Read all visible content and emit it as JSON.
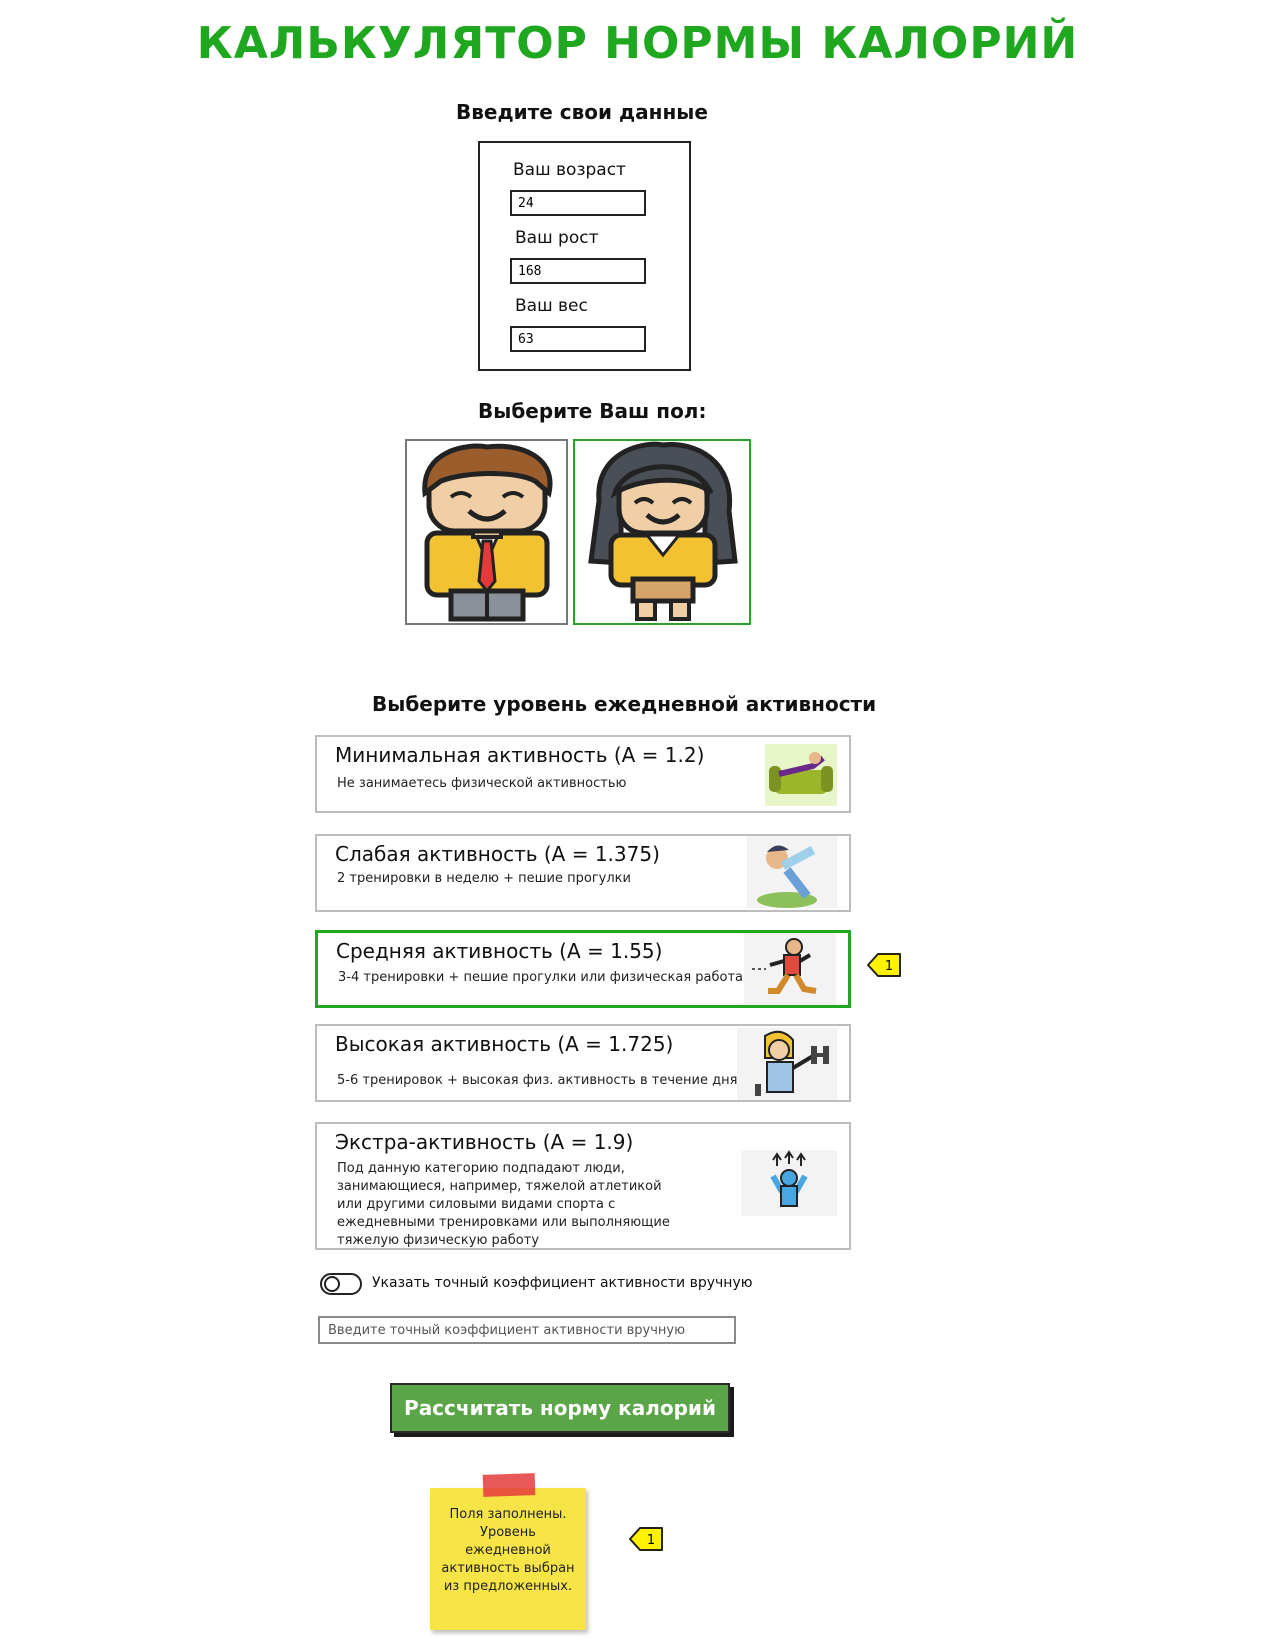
{
  "title": "КАЛЬКУЛЯТОР НОРМЫ КАЛОРИЙ",
  "data_section": {
    "heading": "Введите свои данные",
    "fields": [
      {
        "label": "Ваш возраст",
        "value": "24"
      },
      {
        "label": "Ваш рост",
        "value": "168"
      },
      {
        "label": "Ваш вес",
        "value": "63"
      }
    ]
  },
  "gender_section": {
    "heading": "Выберите Ваш пол:",
    "options": [
      {
        "name": "male",
        "icon": "man-avatar-icon",
        "selected": false
      },
      {
        "name": "female",
        "icon": "woman-avatar-icon",
        "selected": true
      }
    ]
  },
  "activity_section": {
    "heading": "Выберите уровень ежедневной активности",
    "levels": [
      {
        "title": "Минимальная активность (A = 1.2)",
        "desc": "Не занимаетесь физической активностью",
        "icon": "sofa-relax-icon",
        "selected": false
      },
      {
        "title": "Слабая активность (A = 1.375)",
        "desc": "2 тренировки в неделю + пешие прогулки",
        "icon": "stretching-icon",
        "selected": false
      },
      {
        "title": "Средняя активность (A = 1.55)",
        "desc": "3-4 тренировки + пешие прогулки или физическая работа",
        "icon": "running-man-icon",
        "selected": true
      },
      {
        "title": "Высокая активность (A = 1.725)",
        "desc": "5-6 тренировок + высокая физ. активность в течение дня",
        "icon": "dumbbell-woman-icon",
        "selected": false
      },
      {
        "title": "Экстра-активность (A = 1.9)",
        "desc_lines": [
          "Под данную категорию подпадают люди,",
          "занимающиеся,  например, тяжелой атлетикой",
          "или другими силовыми видами спорта с",
          "ежедневными тренировками или выполняющие",
          "тяжелую физическую работу"
        ],
        "icon": "power-person-icon",
        "selected": false
      }
    ]
  },
  "manual": {
    "toggle_label": "Указать точный коэффициент активности вручную",
    "toggle_on": false,
    "input_placeholder": "Введите точный коэффициент активности вручную"
  },
  "calc_button": "Рассчитать норму калорий",
  "sticky_note": {
    "lines": [
      "Поля заполнены.",
      "Уровень",
      "ежедневной",
      "активность выбран",
      "из предложенных."
    ]
  },
  "callouts": [
    {
      "number": "1"
    },
    {
      "number": "1"
    }
  ],
  "colors": {
    "accent": "#1fa81f",
    "button": "#5aa548",
    "sticky": "#f7e547",
    "callout": "#fff200"
  }
}
